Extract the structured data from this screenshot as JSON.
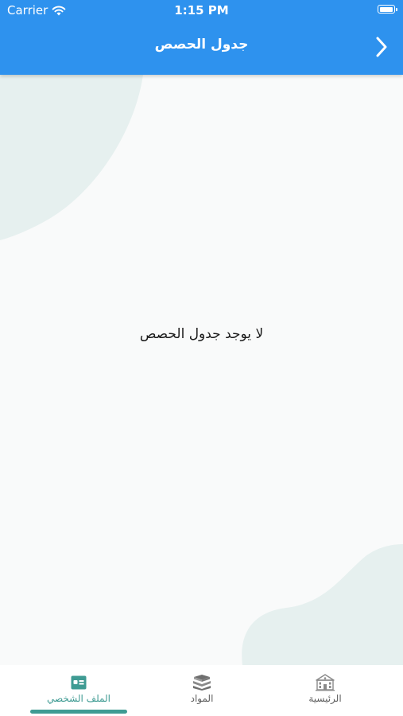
{
  "status_bar": {
    "carrier": "Carrier",
    "time": "1:15 PM",
    "battery_level": 1.0
  },
  "app_bar": {
    "title": "جدول الحصص",
    "back_icon": "chevron-right-icon"
  },
  "content": {
    "empty_message": "لا يوجد جدول الحصص"
  },
  "bottom_nav": {
    "items": [
      {
        "label": "الملف الشخصي",
        "icon": "profile-card-icon",
        "active": true
      },
      {
        "label": "المواد",
        "icon": "books-icon",
        "active": false
      },
      {
        "label": "الرئيسية",
        "icon": "school-building-icon",
        "active": false
      }
    ]
  },
  "colors": {
    "primary": "#2e92ee",
    "accent": "#3f9b93",
    "background": "#f9fafa",
    "blob": "#e6f0ef"
  }
}
